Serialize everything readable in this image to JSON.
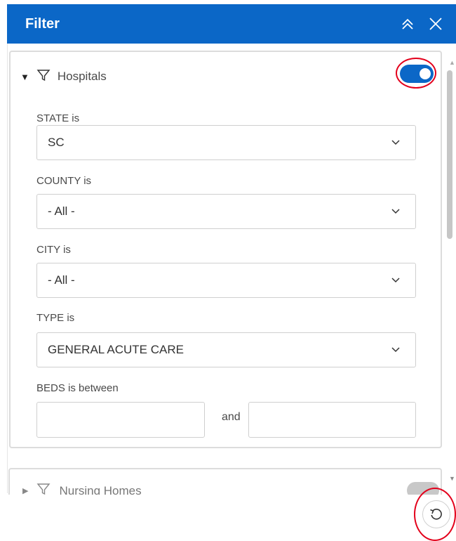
{
  "header": {
    "title": "Filter",
    "collapse_icon": "double-chevron-up-icon",
    "close_icon": "close-icon"
  },
  "group": {
    "title": "Hospitals",
    "expanded": true,
    "toggle_on": true,
    "accent": "#0b67c7",
    "fields": [
      {
        "label": "STATE is",
        "value": "SC"
      },
      {
        "label": "COUNTY is",
        "value": "- All -"
      },
      {
        "label": "CITY is",
        "value": "- All -"
      },
      {
        "label": "TYPE is",
        "value": "GENERAL ACUTE CARE"
      }
    ],
    "range": {
      "label": "BEDS is between",
      "joiner": "and",
      "min": "",
      "max": ""
    }
  },
  "next_group": {
    "title": "Nursing Homes",
    "toggle_on": false
  },
  "footer": {
    "reset_icon": "reset-icon"
  },
  "annotation_color": "#e3001b"
}
